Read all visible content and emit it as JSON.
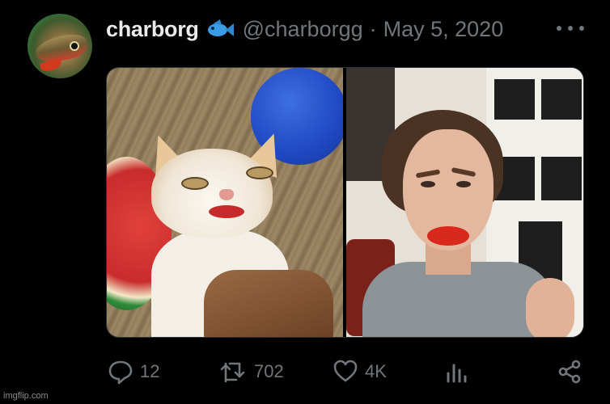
{
  "tweet": {
    "display_name": "charborg",
    "badge_icon": "fish-emoji-icon",
    "handle": "@charborgg",
    "separator": "·",
    "date": "May 5, 2020"
  },
  "actions": {
    "reply_count": "12",
    "retweet_count": "702",
    "like_count": "4K"
  },
  "watermark": "imgflip.com",
  "colors": {
    "background": "#000000",
    "text_primary": "#e7e9ea",
    "text_secondary": "#71767b",
    "border": "#2f3336",
    "fish_blue": "#3a9be6"
  },
  "icons": [
    "more-options-icon",
    "reply-icon",
    "retweet-icon",
    "like-icon",
    "views-icon",
    "share-icon"
  ]
}
